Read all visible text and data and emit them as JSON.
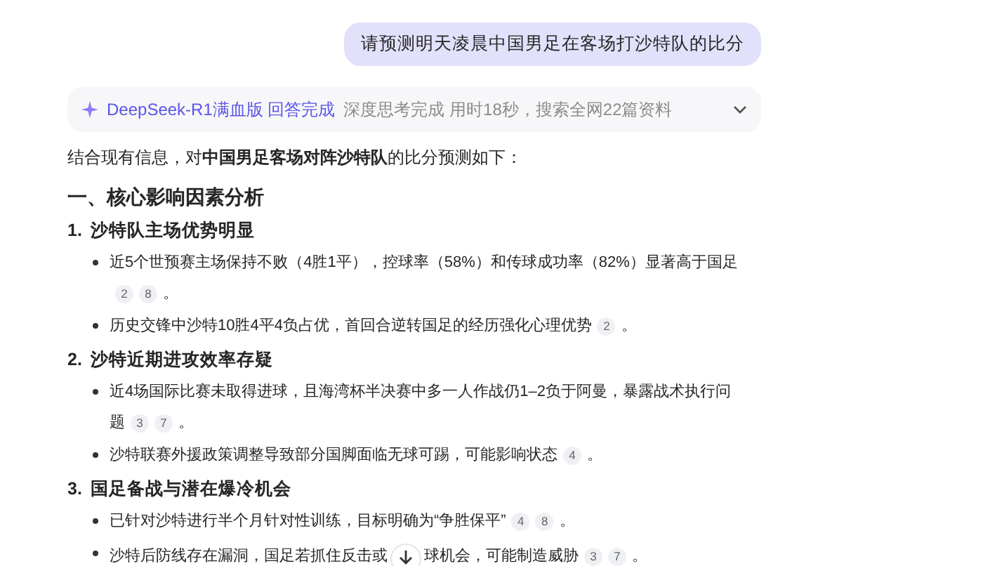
{
  "user_message": "请预测明天凌晨中国男足在客场打沙特队的比分",
  "thinking": {
    "model": "DeepSeek-R1满血版",
    "status": "回答完成",
    "detail": "深度思考完成 用时18秒，搜索全网22篇资料",
    "expanded": false
  },
  "intro": "结合现有信息，对**中国男足客场对阵沙特队**的比分预测如下：",
  "section_title": "一、核心影响因素分析",
  "factors": [
    {
      "number": "1.",
      "title": "沙特队主场优势明显",
      "points": [
        {
          "lines": [
            "近5个世预赛主场保持不败（4胜1平），控球率（58%）和传球成功率（82%）显著高于国足"
          ],
          "citations": [
            "2",
            "8"
          ],
          "end": "。"
        },
        {
          "lines": [
            "历史交锋中沙特10胜4平4负占优，首回合逆转国足的经历强化心理优势"
          ],
          "citations": [
            "2"
          ],
          "end": "。"
        }
      ]
    },
    {
      "number": "2.",
      "title": "沙特近期进攻效率存疑",
      "points": [
        {
          "lines": [
            "近4场国际比赛未取得进球，且海湾杯半决赛中多一人作战仍1–2负于阿曼，暴露战术执行问",
            "题"
          ],
          "citations": [
            "3",
            "7"
          ],
          "end": "。"
        },
        {
          "lines": [
            "沙特联赛外援政策调整导致部分国脚面临无球可踢，可能影响状态"
          ],
          "citations": [
            "4"
          ],
          "end": "。"
        }
      ]
    },
    {
      "number": "3.",
      "title": "国足备战与潜在爆冷机会",
      "points": [
        {
          "lines": [
            "已针对沙特进行半个月针对性训练，目标明确为“争胜保平”"
          ],
          "citations": [
            "4",
            "8"
          ],
          "end": "。"
        },
        {
          "lines": [
            "沙特后防线存在漏洞，国足若抓住反击或",
            "球机会，可能制造威胁"
          ],
          "covered_by_scroll_button": true,
          "citations": [
            "3",
            "7"
          ],
          "end": "。"
        }
      ]
    }
  ]
}
